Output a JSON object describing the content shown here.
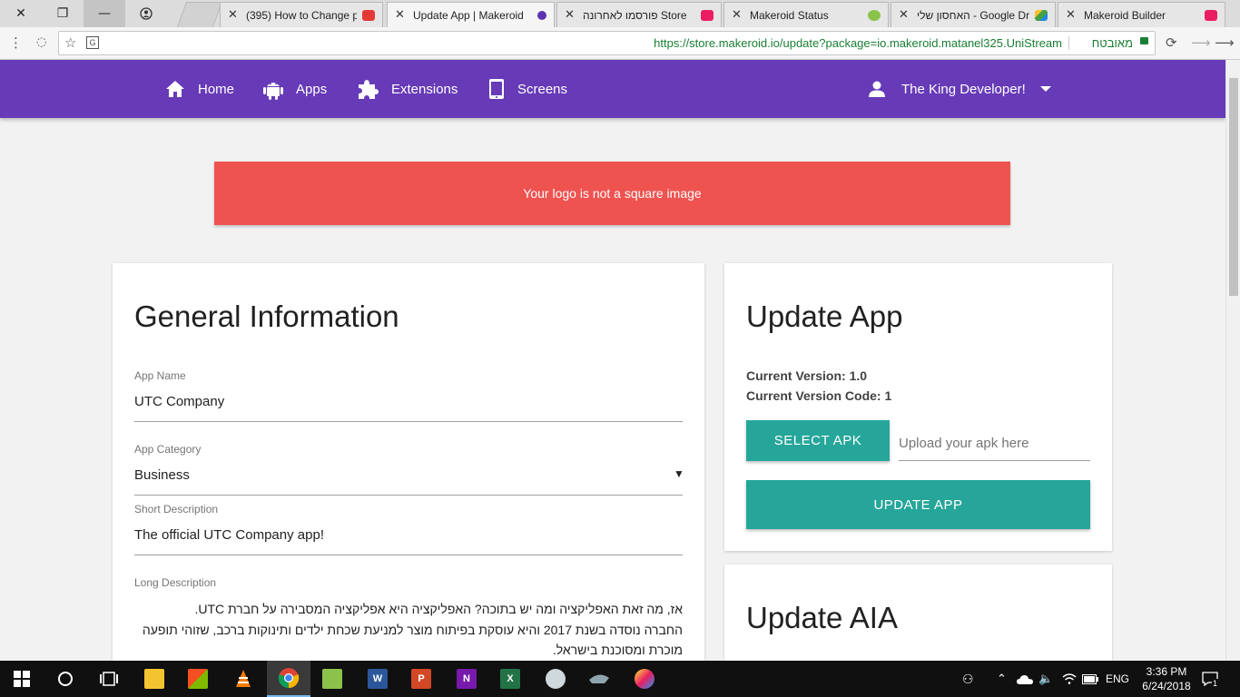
{
  "browser": {
    "tabs": [
      {
        "label": "",
        "active": false
      },
      {
        "label": "(395) How to Change p",
        "active": false
      },
      {
        "label": "Update App | Makeroid",
        "active": true
      },
      {
        "label": "פורסמו לאחרונה Store",
        "active": false
      },
      {
        "label": "Makeroid Status",
        "active": false
      },
      {
        "label": "האחסון שלי - Google Drive",
        "active": false
      },
      {
        "label": "Makeroid Builder",
        "active": false
      }
    ],
    "url": "https://store.makeroid.io/update?package=io.makeroid.matanel325.UniStream",
    "secure_label": "מאובטח"
  },
  "navbar": {
    "home": "Home",
    "apps": "Apps",
    "extensions": "Extensions",
    "screens": "Screens",
    "user": "The King Developer!"
  },
  "alert": {
    "message": "Your logo is not a square image"
  },
  "general": {
    "title": "General Information",
    "app_name_label": "App Name",
    "app_name": "UTC Company",
    "category_label": "App Category",
    "category": "Business",
    "short_desc_label": "Short Description",
    "short_desc": "The official UTC Company app!",
    "long_desc_label": "Long Description",
    "long_desc_lines": [
      "אז, מה זאת האפליקציה ומה יש בתוכה? האפליקציה היא אפליקציה המסבירה על חברת UTC.",
      "החברה נוסדה בשנת 2017 והיא עוסקת בפיתוח מוצר למניעת שכחת ילדים ותינוקות ברכב, שזוהי תופעה",
      "מוכרת ומסוכנת בישראל."
    ]
  },
  "update_app": {
    "title": "Update App",
    "current_version": "Current Version: 1.0",
    "current_version_code": "Current Version Code: 1",
    "select_apk": "SELECT APK",
    "apk_placeholder": "Upload your apk here",
    "update_button": "UPDATE APP"
  },
  "update_aia": {
    "title": "Update AIA"
  },
  "taskbar": {
    "lang": "ENG",
    "time": "3:36 PM",
    "date": "6/24/2018",
    "notifications": "1"
  },
  "colors": {
    "primary": "#673ab7",
    "accent": "#26a69a",
    "alert": "#ef5350"
  }
}
